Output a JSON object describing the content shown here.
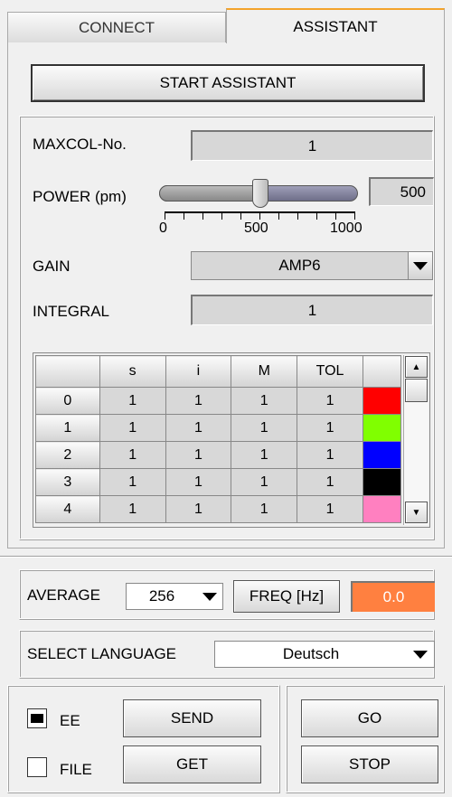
{
  "tabs": {
    "connect": "CONNECT",
    "assistant": "ASSISTANT"
  },
  "start_button": "START ASSISTANT",
  "maxcol": {
    "label": "MAXCOL-No.",
    "value": "1"
  },
  "power": {
    "label": "POWER (pm)",
    "value": "500",
    "level_fraction": 0.5,
    "scale": [
      "0",
      "500",
      "1000"
    ]
  },
  "gain": {
    "label": "GAIN",
    "value": "AMP6"
  },
  "integral": {
    "label": "INTEGRAL",
    "value": "1"
  },
  "table": {
    "columns": [
      "s",
      "i",
      "M",
      "TOL"
    ],
    "rows": [
      {
        "label": "0",
        "cells": [
          "1",
          "1",
          "1",
          "1"
        ],
        "color": "#ff0000"
      },
      {
        "label": "1",
        "cells": [
          "1",
          "1",
          "1",
          "1"
        ],
        "color": "#80ff00"
      },
      {
        "label": "2",
        "cells": [
          "1",
          "1",
          "1",
          "1"
        ],
        "color": "#0000ff"
      },
      {
        "label": "3",
        "cells": [
          "1",
          "1",
          "1",
          "1"
        ],
        "color": "#000000"
      },
      {
        "label": "4",
        "cells": [
          "1",
          "1",
          "1",
          "1"
        ],
        "color": "#ff80c0"
      }
    ]
  },
  "average": {
    "label": "AVERAGE",
    "value": "256"
  },
  "freq": {
    "label": "FREQ [Hz]",
    "value": "0.0",
    "color": "#ff8040"
  },
  "language": {
    "label": "SELECT LANGUAGE",
    "value": "Deutsch"
  },
  "ee": {
    "label": "EE",
    "checked": true
  },
  "file": {
    "label": "FILE",
    "checked": false
  },
  "buttons": {
    "send": "SEND",
    "get": "GET",
    "go": "GO",
    "stop": "STOP"
  }
}
